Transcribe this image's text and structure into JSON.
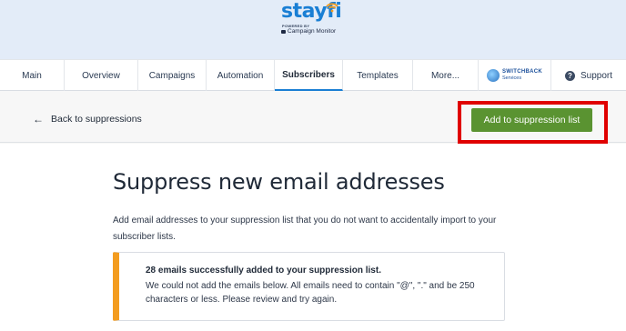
{
  "brand": {
    "logo_text_main": "stay",
    "logo_text_fi": "fi",
    "powered_by": "POWERED BY",
    "partner": "Campaign Monitor",
    "wifi_icon": "wifi-icon",
    "brand_color": "#1a7fd4"
  },
  "nav": {
    "tabs": [
      {
        "label": "Main"
      },
      {
        "label": "Overview"
      },
      {
        "label": "Campaigns"
      },
      {
        "label": "Automation"
      },
      {
        "label": "Subscribers",
        "active": true
      },
      {
        "label": "Templates"
      },
      {
        "label": "More..."
      },
      {
        "label": "SWITCHBACK",
        "sub": "Services"
      },
      {
        "label": "Support"
      }
    ],
    "support_icon": "question-icon"
  },
  "subhead": {
    "back_label": "Back to suppressions",
    "back_icon": "arrow-left-icon",
    "add_button_label": "Add to suppression list",
    "add_button_color": "#5a9331",
    "highlight_color": "#e00000"
  },
  "main": {
    "title": "Suppress new email addresses",
    "description": "Add email addresses to your suppression list that you do not want to accidentally import to your subscriber lists.",
    "alert": {
      "title": "28 emails successfully added to your suppression list.",
      "body": "We could not add the emails below. All emails need to contain \"@\", \".\" and be 250 characters or less. Please review and try again.",
      "accent_color": "#f39c1f"
    }
  }
}
